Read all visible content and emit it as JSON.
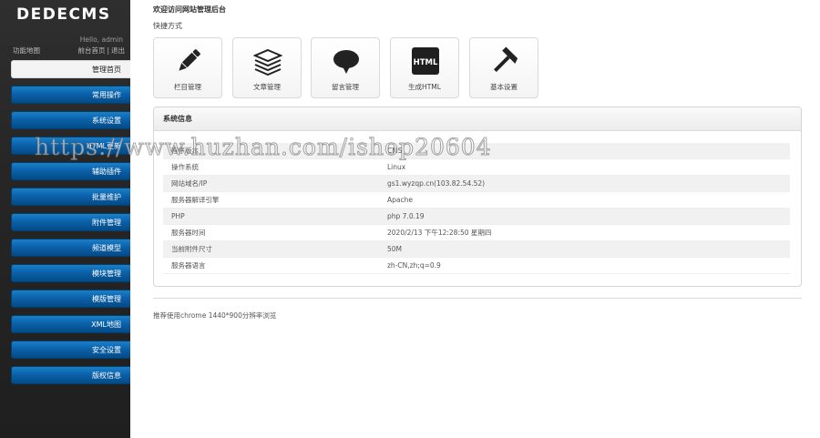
{
  "app": {
    "logo": "DEDECMS"
  },
  "sidebar": {
    "hello": "Hello, admin",
    "function_map": "功能地图",
    "links": [
      "前台首页",
      "退出"
    ],
    "items": [
      {
        "label": "管理首页",
        "active": true
      },
      {
        "label": "常用操作"
      },
      {
        "label": "系统设置"
      },
      {
        "label": "HTML更新"
      },
      {
        "label": "辅助插件"
      },
      {
        "label": "批量维护"
      },
      {
        "label": "附件管理"
      },
      {
        "label": "频道模型"
      },
      {
        "label": "模块管理"
      },
      {
        "label": "模版管理"
      },
      {
        "label": "XML地图"
      },
      {
        "label": "安全设置"
      },
      {
        "label": "版权信息"
      }
    ]
  },
  "main": {
    "welcome": "欢迎访问网站管理后台",
    "quick_title": "快捷方式",
    "tiles": [
      {
        "label": "栏目管理",
        "icon": "pencil-icon"
      },
      {
        "label": "文章管理",
        "icon": "stack-icon"
      },
      {
        "label": "留言管理",
        "icon": "speech-bubble-icon"
      },
      {
        "label": "生成HTML",
        "icon": "html-icon",
        "icon_text": "HTML"
      },
      {
        "label": "基本设置",
        "icon": "hammer-icon"
      }
    ],
    "system_info": {
      "title": "系统信息",
      "rows": [
        {
          "key": "程序版本",
          "value": "CMS"
        },
        {
          "key": "操作系统",
          "value": "Linux"
        },
        {
          "key": "网站域名/IP",
          "value": "gs1.wyzqp.cn(103.82.54.52)"
        },
        {
          "key": "服务器解译引擎",
          "value": "Apache"
        },
        {
          "key": "PHP",
          "value": "php 7.0.19"
        },
        {
          "key": "服务器时间",
          "value": "2020/2/13 下午12:28:50 星期四"
        },
        {
          "key": "当前附件尺寸",
          "value": "50M"
        },
        {
          "key": "服务器语言",
          "value": "zh-CN,zh;q=0.9"
        }
      ]
    },
    "tip": "推荐使用chrome 1440*900分辨率浏览"
  },
  "watermark": "https://www.huzhan.com/ishop20604",
  "colors": {
    "sidebar_bg": "#262626",
    "menu_blue": "#0a5fa6",
    "accent_dark": "#222222"
  }
}
